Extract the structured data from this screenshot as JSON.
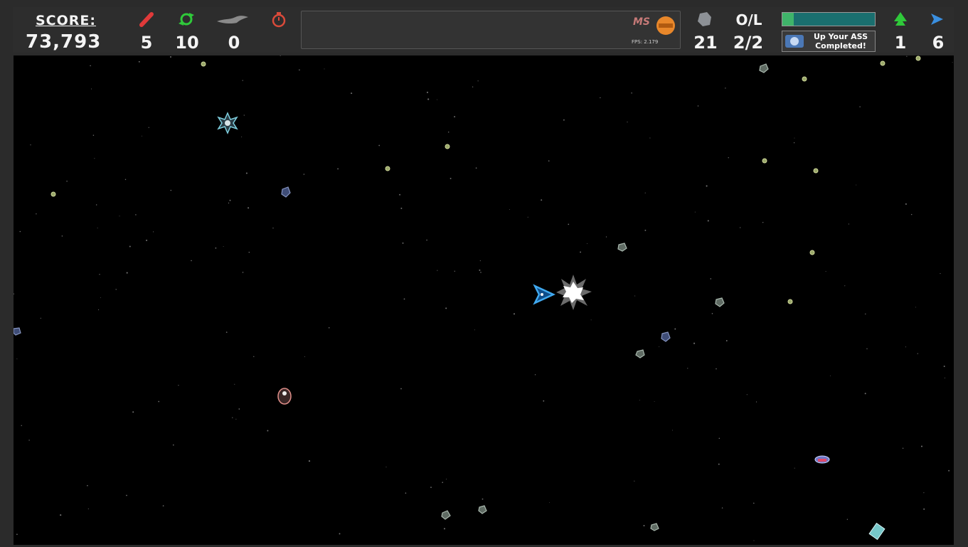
{
  "hud": {
    "score_label": "SCORE:",
    "score_value": "73,793",
    "missiles": "5",
    "powerups": "10",
    "speed": "0",
    "asteroids_left": "21",
    "o_l_label": "O/L",
    "o_l_value": "2/2",
    "trees": "1",
    "ships": "6",
    "fps_text": "FPS: 2.179",
    "ms_label": "MS",
    "achievement_line1": "Up Your ASS",
    "achievement_line2": "Completed!",
    "progress_fraction": 0.12
  },
  "colors": {
    "missile_icon": "#e03a3a",
    "powerup_icon": "#2fc93a",
    "timer_icon": "#d94a3a",
    "ship_icon": "#3a8fe0",
    "tree_icon": "#2fc93a",
    "hud_bg": "#2d2d2d",
    "space_bg": "#000000"
  },
  "icons": {
    "missile": "missile-icon",
    "powerup": "recycle-icon",
    "speed": "wing-icon",
    "timer": "stopwatch-icon",
    "asteroid": "asteroid-icon",
    "tree": "tree-icon",
    "ship": "ship-icon",
    "badge": "hazard-badge-icon"
  }
}
